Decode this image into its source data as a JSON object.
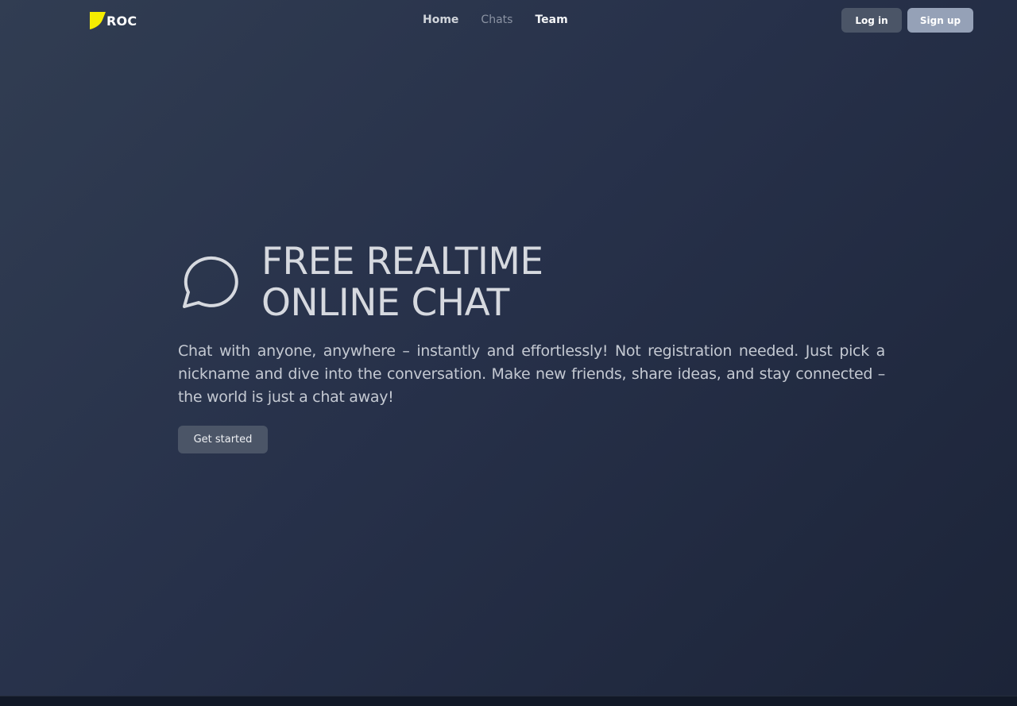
{
  "brand": {
    "name": "ROC",
    "logo_color": "#f5ec00"
  },
  "nav": {
    "links": [
      {
        "label": "Home"
      },
      {
        "label": "Chats"
      },
      {
        "label": "Team"
      }
    ]
  },
  "auth": {
    "login_label": "Log in",
    "signup_label": "Sign up"
  },
  "hero": {
    "icon": "chat-bubble-icon",
    "title_line1": "FREE REALTIME",
    "title_line2": "ONLINE CHAT",
    "description": "Chat with anyone, anywhere – instantly and effortlessly! Not registration needed. Just pick a nickname and dive into the conversation. Make new friends, share ideas, and stay connected – the world is just a chat away!",
    "cta_label": "Get started"
  },
  "colors": {
    "background_start": "#313d52",
    "background_end": "#1c2438",
    "button_dark": "#4b5567",
    "button_light": "#95a1b7"
  }
}
